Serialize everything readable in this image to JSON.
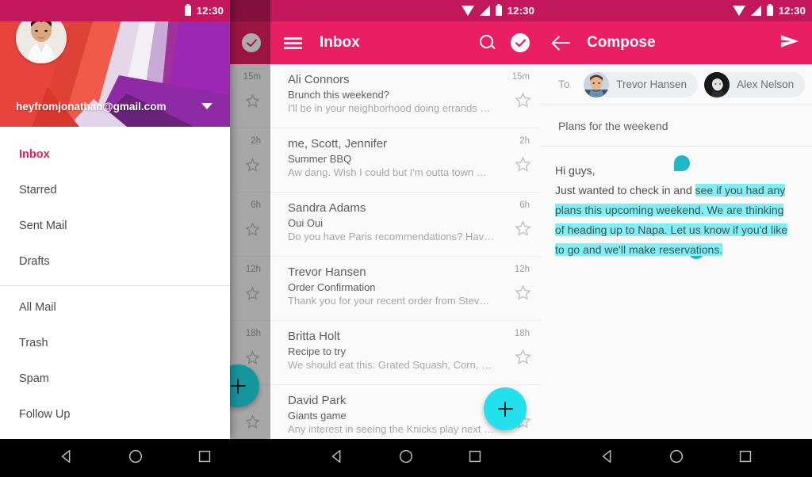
{
  "theme": {
    "primary": "#e91e63",
    "primary_dark": "#c2185b",
    "accent": "#22e0ec",
    "selection_highlight": "#7ef0f5",
    "selection_handle": "#21b7c4"
  },
  "status_bar": {
    "time": "12:30",
    "icons": [
      "wifi-icon",
      "signal-icon",
      "battery-icon"
    ]
  },
  "navigation_bar": {
    "back_label": "Back",
    "home_label": "Home",
    "recents_label": "Recents"
  },
  "screen1_drawer": {
    "account": {
      "email": "heyfromjonathan@gmail.com",
      "avatar_name": "jonathan-avatar",
      "caret_icon": "chevron-down-icon"
    },
    "nav_items_primary": [
      {
        "label": "Inbox",
        "active": true
      },
      {
        "label": "Starred",
        "active": false
      },
      {
        "label": "Sent Mail",
        "active": false
      },
      {
        "label": "Drafts",
        "active": false
      }
    ],
    "nav_items_secondary": [
      {
        "label": "All Mail",
        "active": false
      },
      {
        "label": "Trash",
        "active": false
      },
      {
        "label": "Spam",
        "active": false
      },
      {
        "label": "Follow Up",
        "active": false
      }
    ],
    "background_list_times": [
      "15m",
      "2h",
      "6h",
      "12h",
      "18h",
      ""
    ]
  },
  "screen2_inbox": {
    "toolbar": {
      "menu_icon": "hamburger-menu-icon",
      "title": "Inbox",
      "search_icon": "search-icon",
      "select_icon": "check-circle-icon"
    },
    "fab": {
      "icon": "plus-icon",
      "label": "Compose"
    },
    "emails": [
      {
        "sender": "Ali Connors",
        "subject": "Brunch this weekend?",
        "snippet": "I'll be in your neighborhood doing errands …",
        "time": "15m",
        "starred": false
      },
      {
        "sender": "me, Scott, Jennifer",
        "subject": "Summer BBQ",
        "snippet": "Aw dang. Wish I could but I'm outta town …",
        "time": "2h",
        "starred": false
      },
      {
        "sender": "Sandra Adams",
        "subject": "Oui Oui",
        "snippet": "Do you have Paris recommendations? Hav…",
        "time": "6h",
        "starred": false
      },
      {
        "sender": "Trevor Hansen",
        "subject": "Order Confirmation",
        "snippet": "Thank you for your recent order from Stev…",
        "time": "12h",
        "starred": false
      },
      {
        "sender": "Britta Holt",
        "subject": "Recipe to try",
        "snippet": "We should eat this: Grated Squash, Corn, …",
        "time": "18h",
        "starred": false
      },
      {
        "sender": "David Park",
        "subject": "Giants game",
        "snippet": "Any interest in seeing the Knicks play next …",
        "time": "",
        "starred": false
      }
    ]
  },
  "screen3_compose": {
    "toolbar": {
      "back_icon": "back-arrow-icon",
      "title": "Compose",
      "send_icon": "send-icon"
    },
    "to_field": {
      "label": "To",
      "recipients": [
        {
          "name": "Trevor Hansen",
          "avatar_name": "trevor-hansen-avatar"
        },
        {
          "name": "Alex Nelson",
          "avatar_name": "alex-nelson-avatar"
        }
      ]
    },
    "subject": "Plans for the weekend",
    "message": {
      "line1": "Hi guys,",
      "line2_plain": "Just wanted to check in and ",
      "selected_text": "see if you had any plans this upcoming weekend. We are thinking of heading up to Napa. Let us know if you'd like to go and we'll make reservations."
    }
  }
}
